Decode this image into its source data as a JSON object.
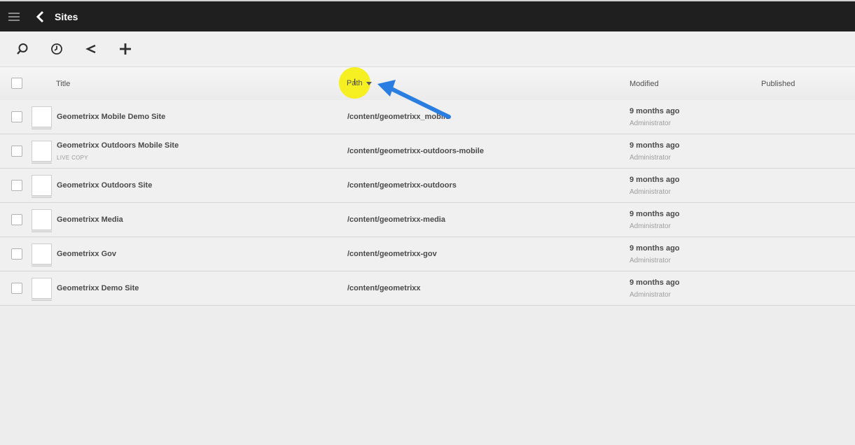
{
  "app": {
    "title": "Sites"
  },
  "toolbar": {
    "icons": [
      "search-icon",
      "clock-icon",
      "share-icon",
      "plus-icon"
    ]
  },
  "table": {
    "columns": {
      "title": "Title",
      "path": "Path",
      "modified": "Modified",
      "published": "Published"
    },
    "rows": [
      {
        "title": "Geometrixx Mobile Demo Site",
        "subtitle": "",
        "path": "/content/geometrixx_mobile",
        "modified": "9 months ago",
        "modified_by": "Administrator"
      },
      {
        "title": "Geometrixx Outdoors Mobile Site",
        "subtitle": "LIVE COPY",
        "path": "/content/geometrixx-outdoors-mobile",
        "modified": "9 months ago",
        "modified_by": "Administrator"
      },
      {
        "title": "Geometrixx Outdoors Site",
        "subtitle": "",
        "path": "/content/geometrixx-outdoors",
        "modified": "9 months ago",
        "modified_by": "Administrator"
      },
      {
        "title": "Geometrixx Media",
        "subtitle": "",
        "path": "/content/geometrixx-media",
        "modified": "9 months ago",
        "modified_by": "Administrator"
      },
      {
        "title": "Geometrixx Gov",
        "subtitle": "",
        "path": "/content/geometrixx-gov",
        "modified": "9 months ago",
        "modified_by": "Administrator"
      },
      {
        "title": "Geometrixx Demo Site",
        "subtitle": "",
        "path": "/content/geometrixx",
        "modified": "9 months ago",
        "modified_by": "Administrator"
      }
    ]
  },
  "colors": {
    "topbar": "#1f1f1f",
    "background": "#ededed",
    "highlight": "#f6ee0a",
    "annotation_arrow": "#2a7de1"
  }
}
